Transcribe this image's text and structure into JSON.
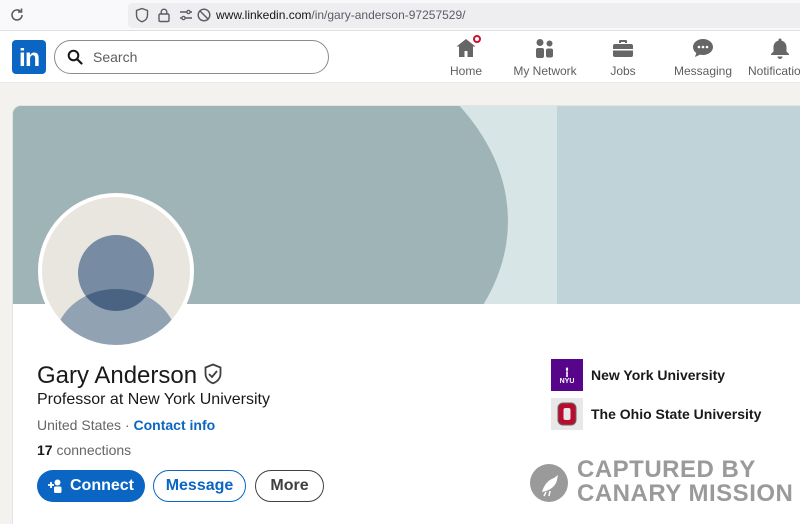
{
  "browser": {
    "url_domain": "www.linkedin.com",
    "url_path": "/in/gary-anderson-97257529/"
  },
  "nav": {
    "logo_text": "in",
    "search_placeholder": "Search",
    "items": [
      {
        "label": "Home",
        "icon": "home-icon",
        "badge": true
      },
      {
        "label": "My Network",
        "icon": "network-icon"
      },
      {
        "label": "Jobs",
        "icon": "briefcase-icon"
      },
      {
        "label": "Messaging",
        "icon": "chat-icon"
      },
      {
        "label": "Notifications",
        "icon": "bell-icon"
      }
    ]
  },
  "profile": {
    "name": "Gary Anderson",
    "headline": "Professor at New York University",
    "location": "United States",
    "separator": " · ",
    "contact_info": "Contact info",
    "connections_count": "17",
    "connections_label": " connections",
    "buttons": {
      "connect": "Connect",
      "message": "Message",
      "more": "More"
    },
    "education": [
      {
        "name": "New York University",
        "logo_text": "NYU"
      },
      {
        "name": "The Ohio State University",
        "logo_text": "O"
      }
    ]
  },
  "watermark": {
    "line1": "CAPTURED BY",
    "line2": "CANARY MISSION"
  },
  "colors": {
    "brand": "#0a66c2",
    "badge": "#cb112d",
    "nyu_purple": "#57068c",
    "osu_red": "#ba0c2f"
  }
}
